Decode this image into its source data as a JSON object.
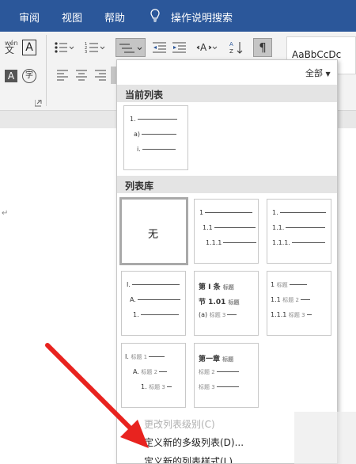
{
  "menubar": {
    "tabs": [
      "审阅",
      "视图",
      "帮助"
    ],
    "search_label": "操作说明搜索"
  },
  "ribbon": {
    "styles_preview": "AaBbCcDc",
    "all_label": "全部"
  },
  "list_panel": {
    "current_header": "当前列表",
    "library_header": "列表库",
    "current_card": [
      "1.",
      "a)",
      "i."
    ],
    "none_label": "无",
    "library_cards": [
      [
        "1",
        "1.1",
        "1.1.1"
      ],
      [
        "1.",
        "1.1.",
        "1.1.1."
      ],
      [
        "I.",
        "A.",
        "1."
      ],
      [
        "第 I 条",
        "节 1.01",
        "(a)"
      ],
      [
        "1",
        "1.1",
        "1.1.1"
      ],
      [
        "I.",
        "A.",
        "1."
      ],
      [
        "第一章",
        "",
        ""
      ]
    ],
    "tags": [
      "标题",
      "标题 1",
      "标题 2",
      "标题 3"
    ],
    "menu_items": [
      "更改列表级别(C)",
      "定义新的多级列表(D)...",
      "定义新的列表样式(L)..."
    ]
  }
}
